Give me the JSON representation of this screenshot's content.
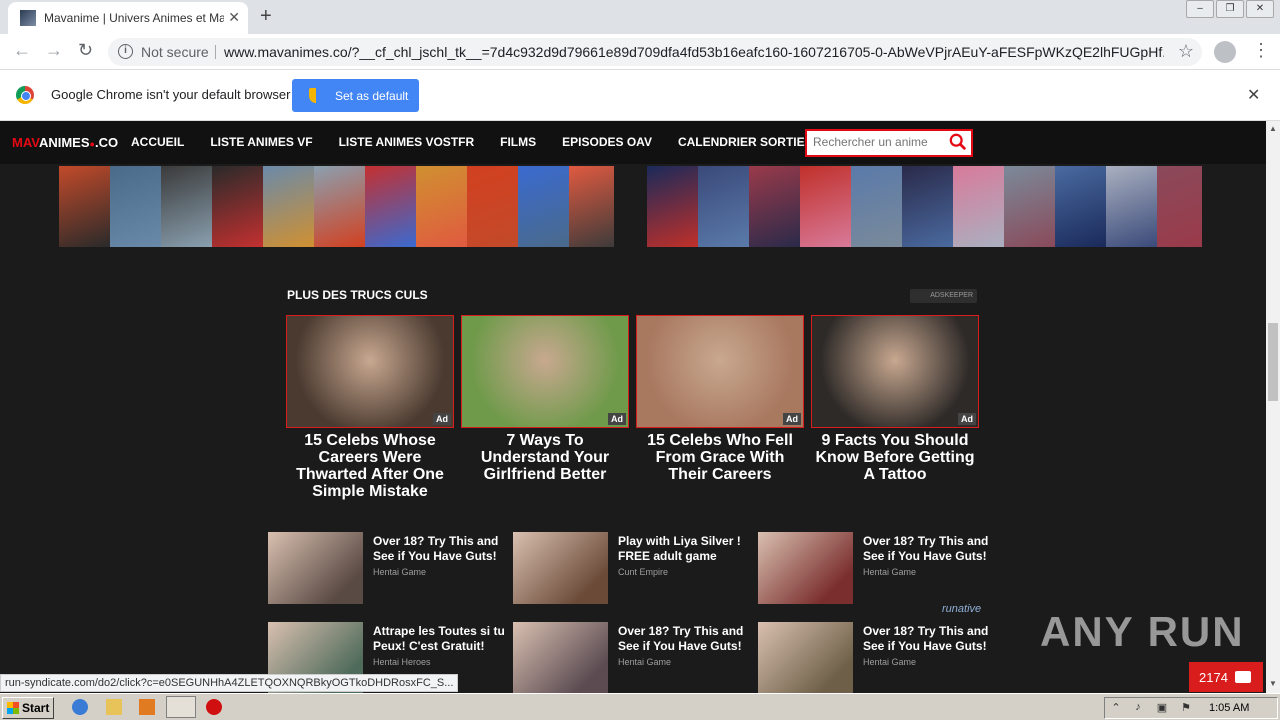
{
  "browser": {
    "tab_title": "Mavanime | Univers Animes et Mang",
    "url": "www.mavanimes.co/?__cf_chl_jschl_tk__=7d4c932d9d79661e89d709dfa4fd53b16eafc160-1607216705-0-AbWeVPjrAEuY-aFESFpWKzQE2lhFUGpHf...",
    "security_label": "Not secure",
    "infobar_text": "Google Chrome isn't your default browser",
    "set_default_label": "Set as default",
    "status_url": "run-syndicate.com/do2/click?c=e0SEGUNHhA4ZLETQOXNQRBkyOGTkoDHDRosxFC_S..."
  },
  "site": {
    "logo_red": "MAV",
    "logo_white": "ANIMES",
    "logo_suffix": ".CO",
    "nav": [
      "ACCUEIL",
      "LISTE ANIMES VF",
      "LISTE ANIMES VOSTFR",
      "FILMS",
      "EPISODES OAV",
      "CALENDRIER SORTIES"
    ],
    "search_placeholder": "Rechercher un anime"
  },
  "ads": {
    "section_title": "PLUS DES TRUCS CULS",
    "network_label": "ADSKEEPER",
    "badge": "Ad",
    "cards": [
      {
        "title": "15 Celebs Whose Careers Were Thwarted After One Simple Mistake",
        "color": "#4a3a30"
      },
      {
        "title": "7 Ways To Understand Your Girlfriend Better",
        "color": "#6f9a4a"
      },
      {
        "title": "15 Celebs Who Fell From Grace With Their Careers",
        "color": "#a8785f"
      },
      {
        "title": "9 Facts You Should Know Before Getting A Tattoo",
        "color": "#2e2a28"
      }
    ]
  },
  "native_ads": {
    "network_label": "runative",
    "items": [
      {
        "title": "Over 18? Try This and See if You Have Guts!",
        "source": "Hentai Game",
        "color": "#5a4a44"
      },
      {
        "title": "Play with Liya Silver ! FREE adult game",
        "source": "Cunt Empire",
        "color": "#6b4a38"
      },
      {
        "title": "Over 18? Try This and See if You Have Guts!",
        "source": "Hentai Game",
        "color": "#7a2e2e"
      },
      {
        "title": "Attrape les Toutes si tu Peux! C'est Gratuit!",
        "source": "Hentai Heroes",
        "color": "#4e6a5a"
      },
      {
        "title": "Over 18? Try This and See if You Have Guts!",
        "source": "Hentai Game",
        "color": "#5c4c52"
      },
      {
        "title": "Over 18? Try This and See if You Have Guts!",
        "source": "Hentai Game",
        "color": "#6e6048"
      }
    ]
  },
  "banner_colors_left": [
    "#c24a2a",
    "#4a6a8a",
    "#3a3a3a",
    "#2a2a2a",
    "#6a8aaa",
    "#8aa0b0",
    "#c43030",
    "#d09030",
    "#d24020",
    "#3a6ad0",
    "#e05a40"
  ],
  "banner_colors_right": [
    "#1a2a5a",
    "#3a4a7a",
    "#9a3a4a",
    "#c0302a",
    "#5a7aaa",
    "#2a2a4a",
    "#d87a9a",
    "#7a8a9a",
    "#4a6aa0",
    "#aab0c0",
    "#8a4a5a"
  ],
  "overlay": {
    "watermark": "ANY RUN",
    "chat_count": "2174"
  },
  "taskbar": {
    "start_label": "Start",
    "clock": "1:05 AM"
  }
}
